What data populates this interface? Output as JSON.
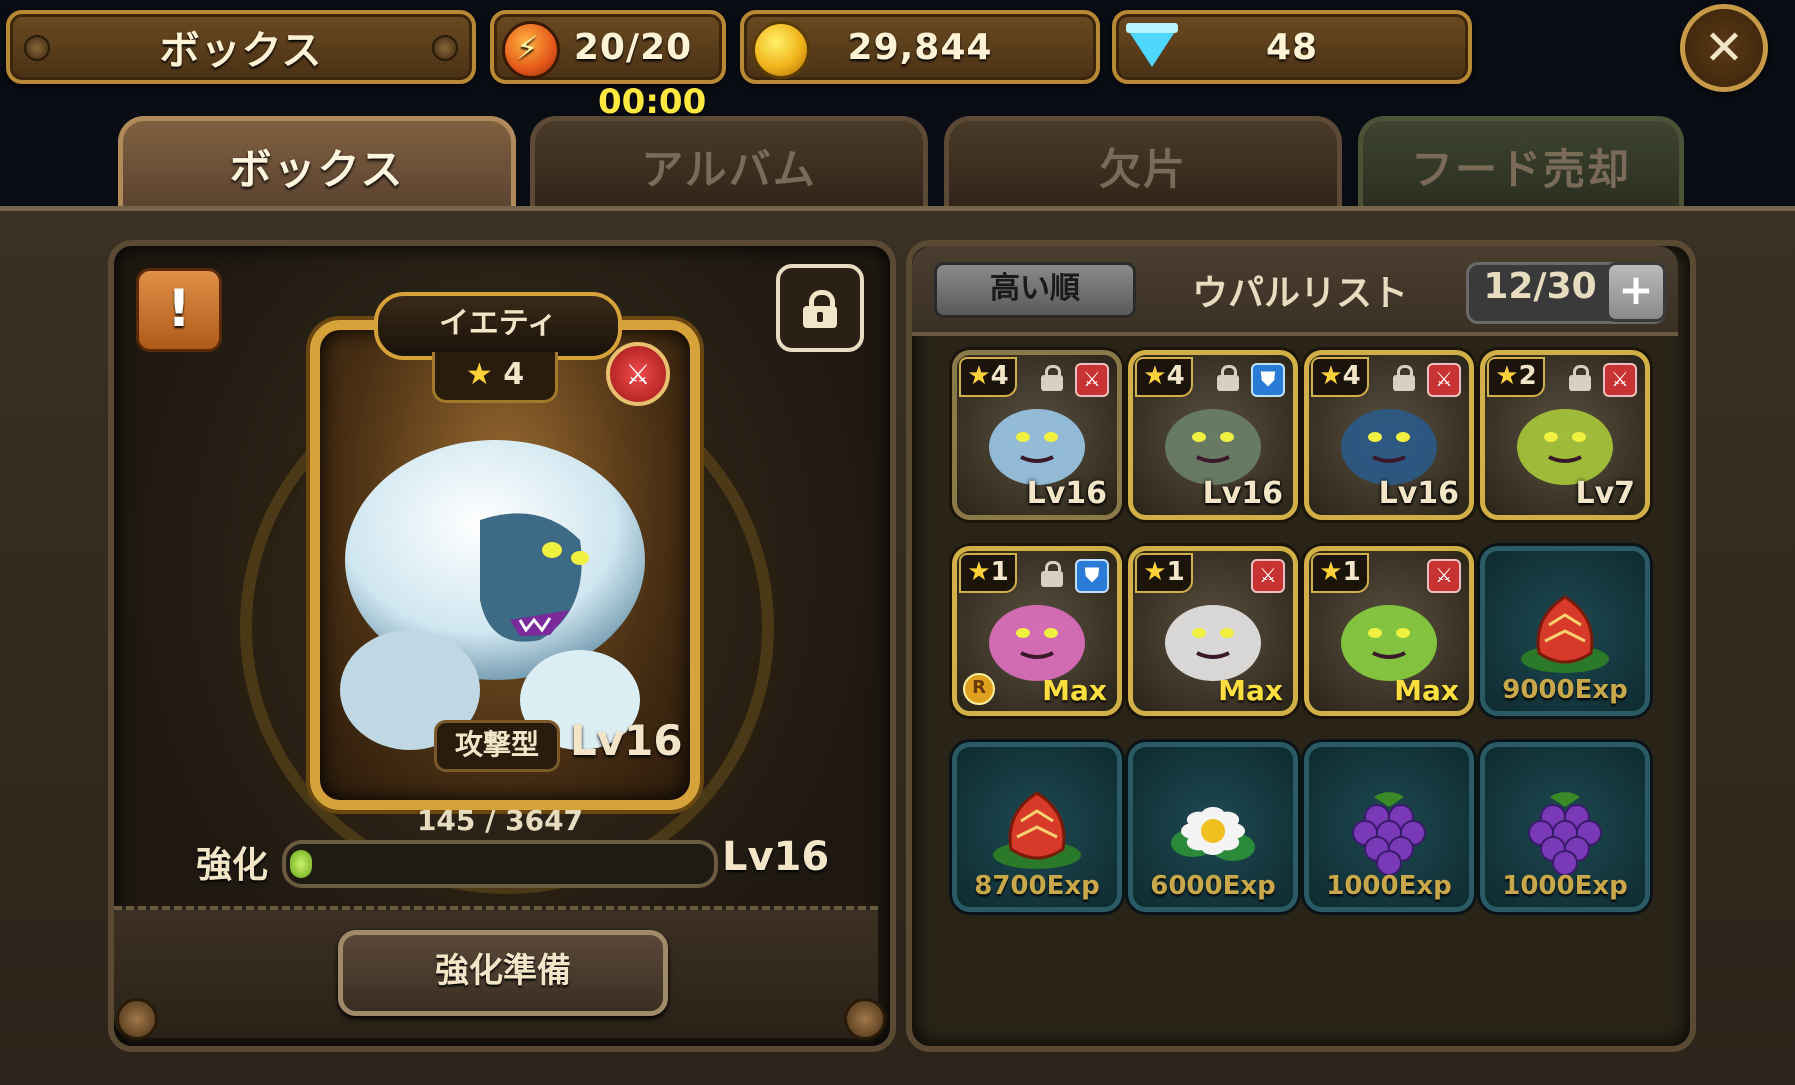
{
  "header": {
    "title": "ボックス",
    "energy": "20/20",
    "timer": "00:00",
    "gold": "29,844",
    "gems": "48"
  },
  "tabs": [
    {
      "label": "ボックス",
      "active": true
    },
    {
      "label": "アルバム",
      "active": false
    },
    {
      "label": "欠片",
      "active": false
    },
    {
      "label": "フード売却",
      "active": false
    }
  ],
  "detail": {
    "name": "イエティ",
    "stars": "4",
    "type": "攻撃型",
    "level": "Lv16",
    "exp_text": "145 / 3647",
    "exp_progress": 0.04,
    "enhance_label": "強化",
    "enhance_level": "Lv16",
    "prepare_button": "強化準備",
    "alert_icon": "!"
  },
  "list": {
    "sort_label": "高い順",
    "title": "ウパルリスト",
    "count": "12/30",
    "add_icon": "+",
    "monsters": [
      {
        "stars": "4",
        "level": "Lv16",
        "locked": true,
        "role": "attack",
        "color": "#9ac8e8"
      },
      {
        "stars": "4",
        "level": "Lv16",
        "locked": true,
        "role": "defense",
        "color": "#6a8068"
      },
      {
        "stars": "4",
        "level": "Lv16",
        "locked": true,
        "role": "attack",
        "color": "#2a5a88"
      },
      {
        "stars": "2",
        "level": "Lv7",
        "locked": true,
        "role": "attack",
        "color": "#a8c83a"
      },
      {
        "stars": "1",
        "level": "Max",
        "locked": true,
        "role": "defense",
        "color": "#e070c0",
        "rare": "R"
      },
      {
        "stars": "1",
        "level": "Max",
        "locked": false,
        "role": "attack",
        "color": "#e8e8e8"
      },
      {
        "stars": "1",
        "level": "Max",
        "locked": false,
        "role": "attack",
        "color": "#8ad040"
      }
    ],
    "foods": [
      {
        "exp": "9000Exp",
        "kind": "flower-bud"
      },
      {
        "exp": "8700Exp",
        "kind": "flower-bud"
      },
      {
        "exp": "6000Exp",
        "kind": "daisy"
      },
      {
        "exp": "1000Exp",
        "kind": "grapes"
      },
      {
        "exp": "1000Exp",
        "kind": "grapes"
      }
    ]
  }
}
